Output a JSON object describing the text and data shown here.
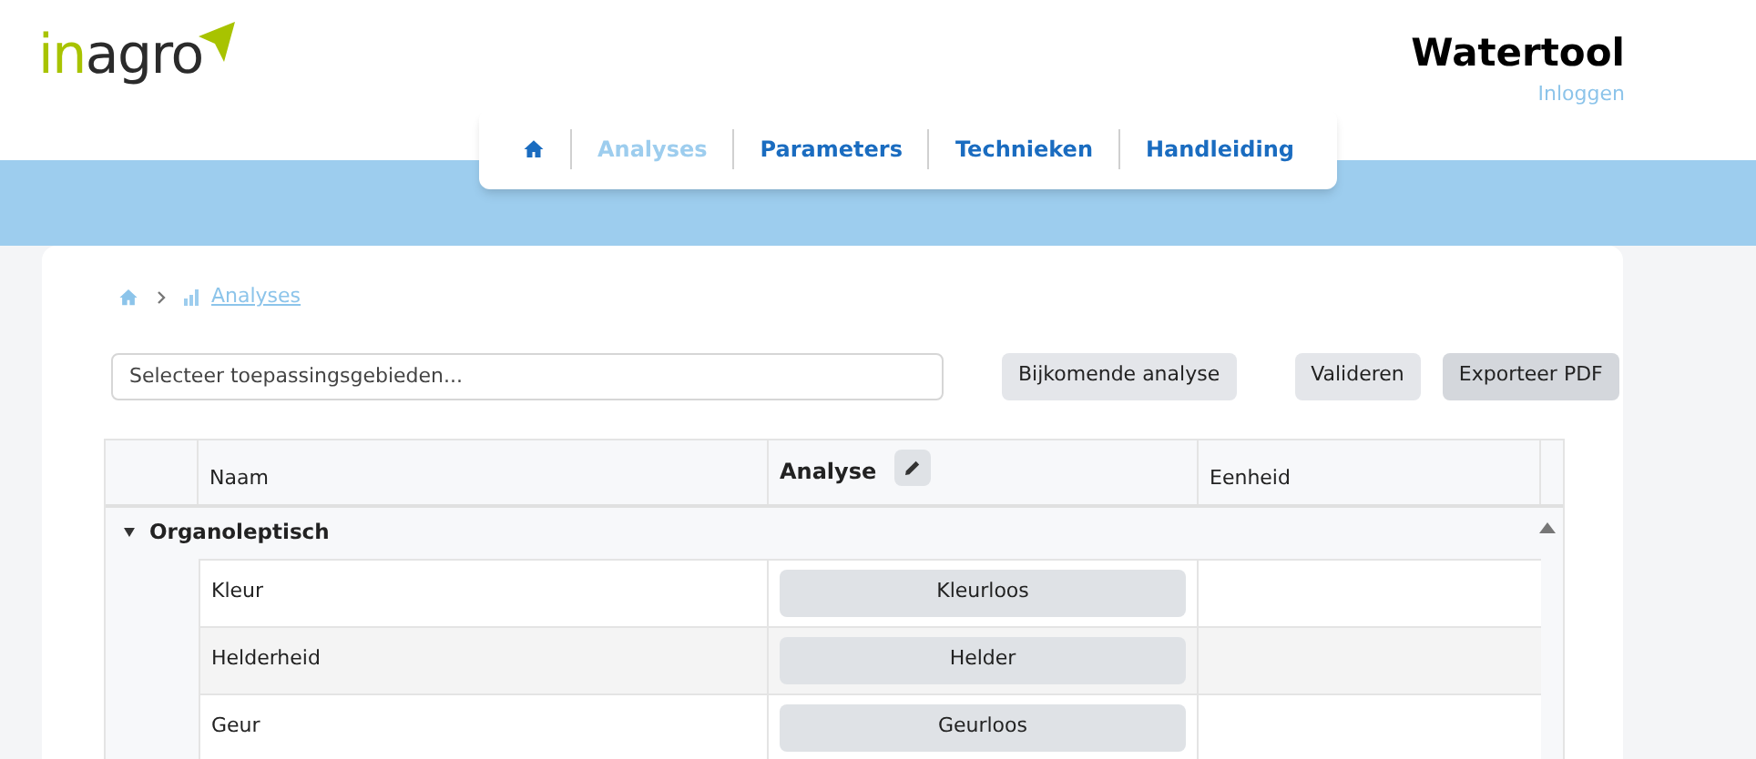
{
  "logo": {
    "part_1": "in",
    "part_2": "agro"
  },
  "header": {
    "title": "Watertool",
    "login": "Inloggen"
  },
  "nav": [
    {
      "kind": "home",
      "selected": false
    },
    {
      "kind": "link",
      "label": "Analyses",
      "selected": true
    },
    {
      "kind": "link",
      "label": "Parameters",
      "selected": false
    },
    {
      "kind": "link",
      "label": "Technieken",
      "selected": false
    },
    {
      "kind": "link",
      "label": "Handleiding",
      "selected": false
    }
  ],
  "breadcrumb": {
    "current": "Analyses"
  },
  "search": {
    "placeholder": "Selecteer toepassingsgebieden..."
  },
  "buttons": [
    {
      "label": "Bijkomende analyse",
      "active": false
    },
    {
      "label": "Valideren",
      "active": false
    },
    {
      "label": "Exporteer PDF",
      "active": true
    }
  ],
  "table": {
    "columns": [
      "Naam",
      "Analyse",
      "Eenheid"
    ],
    "groups": [
      {
        "label": "Organoleptisch",
        "expanded": true,
        "rows": [
          {
            "naam": "Kleur",
            "analyse": "Kleurloos"
          },
          {
            "naam": "Helderheid",
            "analyse": "Helder"
          },
          {
            "naam": "Geur",
            "analyse": "Geurloos"
          }
        ]
      }
    ]
  }
}
